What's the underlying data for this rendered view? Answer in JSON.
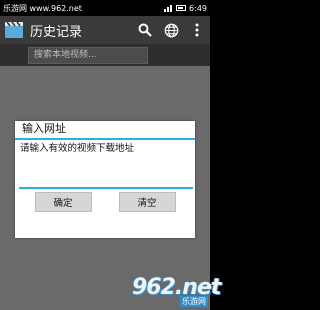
{
  "status_bar": {
    "watermark": "乐游网 www.962.net",
    "time": "6:49"
  },
  "action_bar": {
    "title": "历史记录",
    "icons": [
      "video-camera-icon",
      "search-icon",
      "globe-icon",
      "overflow-menu-icon"
    ]
  },
  "search": {
    "placeholder": "搜索本地视频..."
  },
  "dialog": {
    "title": "输入网址",
    "input_value": "请输入有效的视频下载地址",
    "confirm_label": "确定",
    "clear_label": "清空"
  },
  "watermark_logo": {
    "big": "962.net",
    "small": "乐游网"
  },
  "colors": {
    "accent": "#2ab1e0",
    "action_bar": "#3a3a3a",
    "content": "#6a6a6a"
  }
}
